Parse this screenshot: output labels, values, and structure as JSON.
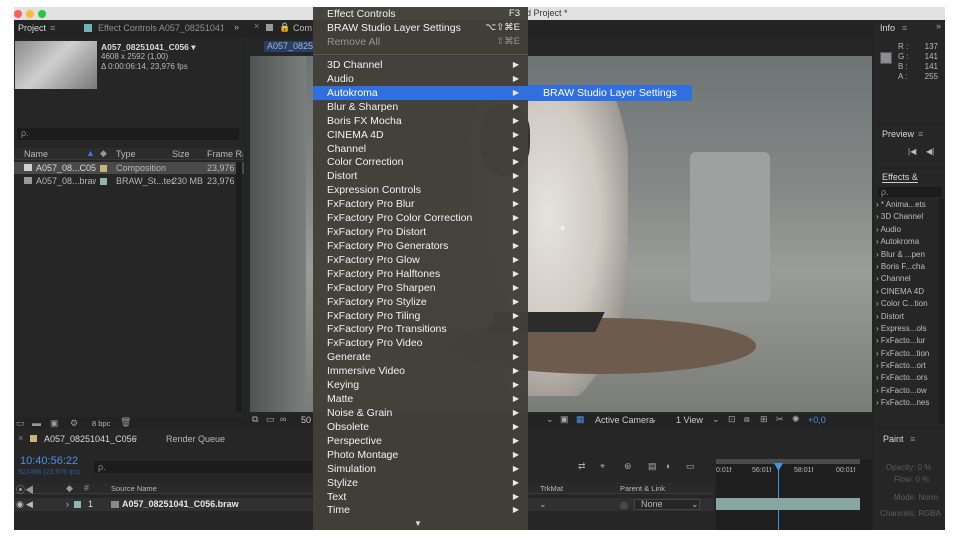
{
  "titlebar": {
    "title": "d Project *"
  },
  "project_panel": {
    "tab_label": "Project",
    "effect_controls_tab": "Effect Controls A057_08251041_",
    "selected_item": {
      "name": "A057_08251041_C056 ▾",
      "size": "4608 x 2592 (1,00)",
      "duration": "Δ 0:00:06:14, 23,976 fps"
    },
    "columns": [
      "Name",
      "Type",
      "Size",
      "Frame Ra..."
    ],
    "items": [
      {
        "name": "A057_08...C056",
        "type": "Composition",
        "size": "",
        "fps": "23,976"
      },
      {
        "name": "A057_08...braw",
        "type": "BRAW_St...ter",
        "size": "230 MB",
        "fps": "23,976"
      }
    ],
    "bpc": "8 bpc"
  },
  "viewer": {
    "tab_label": "Com",
    "comp_chip": "A057_0825",
    "zoom": "50",
    "camera": "Active Camera",
    "views": "1 View",
    "exposure": "+0,0"
  },
  "info_panel": {
    "tab_label": "Info",
    "values": [
      {
        "label": "R :",
        "value": "137"
      },
      {
        "label": "G :",
        "value": "141"
      },
      {
        "label": "B :",
        "value": "141"
      },
      {
        "label": "A :",
        "value": "255"
      }
    ]
  },
  "preview_panel": {
    "tab_label": "Preview"
  },
  "effects_panel": {
    "tab_label": "Effects &",
    "items": [
      "* Anima...ets",
      "3D Channel",
      "Audio",
      "Autokroma",
      "Blur & ...pen",
      "Boris F...cha",
      "Channel",
      "CINEMA 4D",
      "Color C...tion",
      "Distort",
      "Express...ols",
      "FxFacto...lur",
      "FxFacto...tion",
      "FxFacto...ort",
      "FxFacto...ors",
      "FxFacto...ow",
      "FxFacto...nes"
    ]
  },
  "timeline": {
    "comp_tab": "A057_08251041_C056",
    "render_queue_tab": "Render Queue",
    "timecode": "10:40:56:22",
    "fps_sub": "922486 (23.976 fps)",
    "search_placeholder": "ρ.",
    "columns": {
      "source_name": "Source Name",
      "trkmat": "TrkMat",
      "parent": "Parent & Link",
      "t": "T"
    },
    "layer": {
      "index": "1",
      "name": "A057_08251041_C056.braw",
      "parent": "None"
    },
    "ruler": [
      "0:01f",
      "56:01f",
      "58:01f",
      "00:01f"
    ]
  },
  "paint_panel": {
    "tab_label": "Paint",
    "fields": [
      {
        "label": "Opacity:",
        "value": "0 %"
      },
      {
        "label": "Flow:",
        "value": "0 %"
      },
      {
        "label": "Mode:",
        "value": "Norm"
      },
      {
        "label": "Channels:",
        "value": "RGBA"
      }
    ]
  },
  "menu": {
    "top_items": [
      {
        "label": "Effect Controls",
        "shortcut": "F3"
      },
      {
        "label": "BRAW Studio Layer Settings",
        "shortcut": "⌥⇧⌘E"
      },
      {
        "label": "Remove All",
        "shortcut": "⇧⌘E"
      }
    ],
    "categories": [
      "3D Channel",
      "Audio",
      "Autokroma",
      "Blur & Sharpen",
      "Boris FX Mocha",
      "CINEMA 4D",
      "Channel",
      "Color Correction",
      "Distort",
      "Expression Controls",
      "FxFactory Pro Blur",
      "FxFactory Pro Color Correction",
      "FxFactory Pro Distort",
      "FxFactory Pro Generators",
      "FxFactory Pro Glow",
      "FxFactory Pro Halftones",
      "FxFactory Pro Sharpen",
      "FxFactory Pro Stylize",
      "FxFactory Pro Tiling",
      "FxFactory Pro Transitions",
      "FxFactory Pro Video",
      "Generate",
      "Immersive Video",
      "Keying",
      "Matte",
      "Noise & Grain",
      "Obsolete",
      "Perspective",
      "Photo Montage",
      "Simulation",
      "Stylize",
      "Text",
      "Time"
    ],
    "selected": "Autokroma",
    "submenu_item": "BRAW Studio Layer Settings",
    "arrow_glyph": "▶",
    "more_glyph": "▼"
  }
}
